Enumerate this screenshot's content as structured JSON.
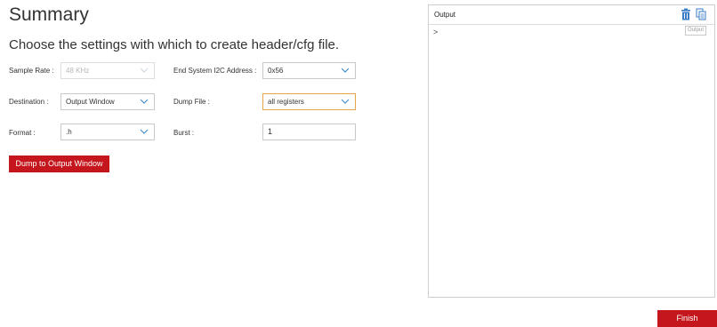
{
  "page": {
    "title": "Summary",
    "subtitle": "Choose the settings with which to create header/cfg file."
  },
  "form": {
    "sample_rate": {
      "label": "Sample Rate :",
      "value": "48 KHz"
    },
    "i2c_address": {
      "label": "End System I2C Address :",
      "value": "0x56"
    },
    "destination": {
      "label": "Destination :",
      "value": "Output Window"
    },
    "dump_file": {
      "label": "Dump File :",
      "value": "all registers"
    },
    "format": {
      "label": "Format :",
      "value": ".h"
    },
    "burst": {
      "label": "Burst :",
      "value": "1"
    }
  },
  "actions": {
    "dump_label": "Dump to Output Window",
    "finish_label": "Finish"
  },
  "output": {
    "title": "Output",
    "prompt": ">",
    "tag": "Output",
    "icons": [
      "trash-icon",
      "copy-icon"
    ]
  },
  "colors": {
    "accent_red": "#c4161c",
    "chevron_blue": "#4a90c8",
    "focus_border": "#e5a64a",
    "icon_blue": "#3a7cc7"
  }
}
